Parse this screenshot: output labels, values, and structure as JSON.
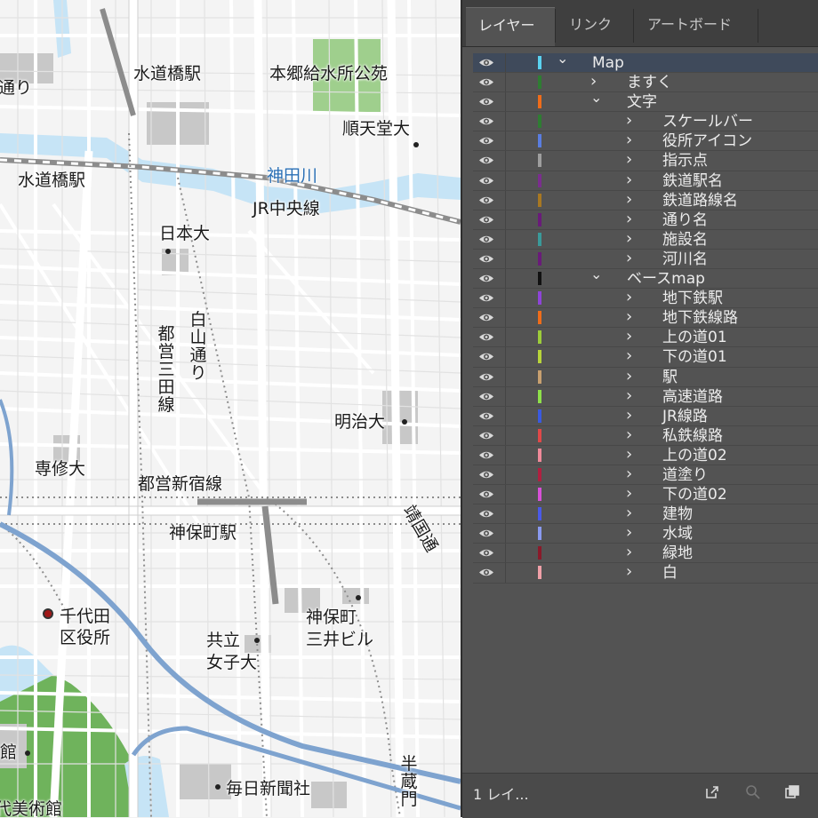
{
  "map": {
    "labels": {
      "suidobashi_station_top": "水道橋駅",
      "hongo_park": "本郷給水所公苑",
      "juntendo": "順天堂大",
      "kanda_river": "神田川",
      "suidobashi_station_left": "水道橋駅",
      "jr_chuo_line": "JR中央線",
      "nihon_univ": "日本大",
      "hakusan_dori": "白山通り",
      "mita_line": "都営三田線",
      "meiji_univ": "明治大",
      "senshu_univ": "専修大",
      "shinjuku_line": "都営新宿線",
      "jimbocho_station": "神保町駅",
      "chiyoda_office": "千代田\n区役所",
      "kyoritsu": "共立\n女子大",
      "jimbocho_mitsui": "神保町\n三井ビル",
      "mainichi": "毎日新聞社",
      "hanzomon": "半蔵門",
      "yasukuni": "靖国通",
      "top_left_partial": "通り",
      "left_partial_hall": "館",
      "museum_partial": "代美術館"
    }
  },
  "panel": {
    "tabs": [
      "レイヤー",
      "リンク",
      "アートボード"
    ],
    "active_tab": "レイヤー",
    "layers": [
      {
        "name": "Map",
        "level": 0,
        "expanded": true,
        "color": "#5ad2f0",
        "selected": true
      },
      {
        "name": "ますく",
        "level": 1,
        "expanded": false,
        "color": "#2e7d32"
      },
      {
        "name": "文字",
        "level": 1,
        "expanded": true,
        "color": "#ef6c1a"
      },
      {
        "name": "スケールバー",
        "level": 2,
        "expanded": false,
        "color": "#2e7d32"
      },
      {
        "name": "役所アイコン",
        "level": 2,
        "expanded": false,
        "color": "#5a7de0"
      },
      {
        "name": "指示点",
        "level": 2,
        "expanded": false,
        "color": "#9e9e9e"
      },
      {
        "name": "鉄道駅名",
        "level": 2,
        "expanded": false,
        "color": "#7b2d8e"
      },
      {
        "name": "鉄道路線名",
        "level": 2,
        "expanded": false,
        "color": "#a87822"
      },
      {
        "name": "通り名",
        "level": 2,
        "expanded": false,
        "color": "#6a1b7a"
      },
      {
        "name": "施設名",
        "level": 2,
        "expanded": false,
        "color": "#3a9a9a"
      },
      {
        "name": "河川名",
        "level": 2,
        "expanded": false,
        "color": "#6a1b7a"
      },
      {
        "name": "ベースmap",
        "level": 1,
        "expanded": true,
        "color": "#111111"
      },
      {
        "name": "地下鉄駅",
        "level": 2,
        "expanded": false,
        "color": "#8e44d8"
      },
      {
        "name": "地下鉄線路",
        "level": 2,
        "expanded": false,
        "color": "#ef6c1a"
      },
      {
        "name": "上の道01",
        "level": 2,
        "expanded": false,
        "color": "#9ccc3a"
      },
      {
        "name": "下の道01",
        "level": 2,
        "expanded": false,
        "color": "#b8d43a"
      },
      {
        "name": "駅",
        "level": 2,
        "expanded": false,
        "color": "#c8a070"
      },
      {
        "name": "高速道路",
        "level": 2,
        "expanded": false,
        "color": "#8ee04a"
      },
      {
        "name": "JR線路",
        "level": 2,
        "expanded": false,
        "color": "#3a5ae0"
      },
      {
        "name": "私鉄線路",
        "level": 2,
        "expanded": false,
        "color": "#e04848"
      },
      {
        "name": "上の道02",
        "level": 2,
        "expanded": false,
        "color": "#f08a9a"
      },
      {
        "name": "道塗り",
        "level": 2,
        "expanded": false,
        "color": "#b02040"
      },
      {
        "name": "下の道02",
        "level": 2,
        "expanded": false,
        "color": "#d850d8"
      },
      {
        "name": "建物",
        "level": 2,
        "expanded": false,
        "color": "#4a5ae8"
      },
      {
        "name": "水域",
        "level": 2,
        "expanded": false,
        "color": "#8a9af0"
      },
      {
        "name": "緑地",
        "level": 2,
        "expanded": false,
        "color": "#8a1a2a"
      },
      {
        "name": "白",
        "level": 2,
        "expanded": false,
        "color": "#f0a0a8"
      }
    ],
    "footer": {
      "count": "1 レイ..."
    }
  }
}
